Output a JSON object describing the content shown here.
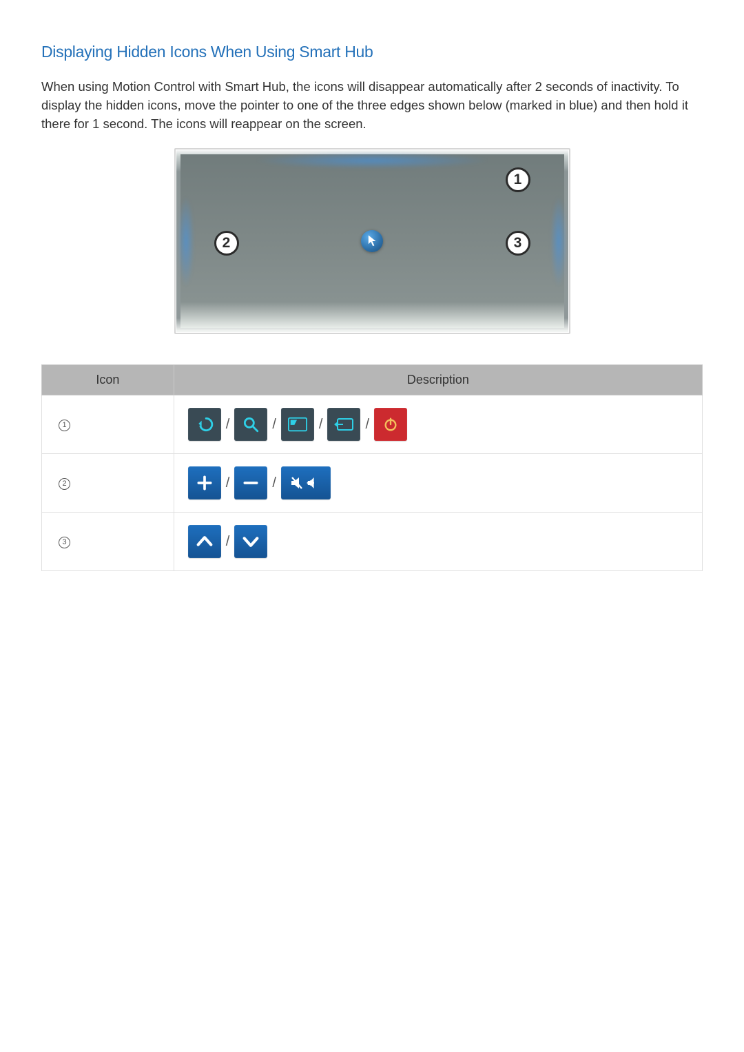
{
  "title": "Displaying Hidden Icons When Using Smart Hub",
  "body": "When using Motion Control with Smart Hub, the icons will disappear automatically after 2 seconds of inactivity. To display the hidden icons, move the pointer to one of the three edges shown below (marked in blue) and then hold it there for 1 second. The icons will reappear on the screen.",
  "diagram": {
    "callouts": [
      "1",
      "2",
      "3"
    ],
    "pointer_name": "motion-pointer"
  },
  "table": {
    "headers": {
      "icon": "Icon",
      "desc": "Description"
    },
    "rows": [
      {
        "num": "1",
        "icons": [
          "return-icon",
          "search-icon",
          "smart-hub-icon",
          "source-icon",
          "power-icon"
        ]
      },
      {
        "num": "2",
        "icons": [
          "volume-up-icon",
          "volume-down-icon",
          "mute-speaker-icon"
        ]
      },
      {
        "num": "3",
        "icons": [
          "channel-up-icon",
          "channel-down-icon"
        ]
      }
    ]
  },
  "separator": "/"
}
